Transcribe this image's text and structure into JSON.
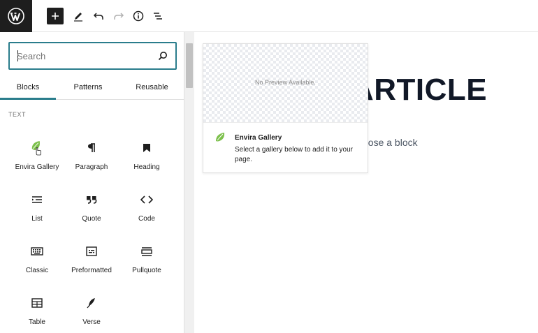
{
  "toolbar": {
    "logo": "wordpress-icon",
    "add": "plus-icon",
    "tools": "pencil-icon",
    "undo": "undo-icon",
    "redo": "redo-icon",
    "details": "info-icon",
    "outline": "list-view-icon"
  },
  "inserter": {
    "search": {
      "placeholder": "Search",
      "value": ""
    },
    "tabs": [
      {
        "label": "Blocks",
        "active": true
      },
      {
        "label": "Patterns",
        "active": false
      },
      {
        "label": "Reusable",
        "active": false
      }
    ],
    "category": "TEXT",
    "blocks": [
      {
        "label": "Envira Gallery",
        "icon": "leaf-icon"
      },
      {
        "label": "Paragraph",
        "icon": "pilcrow-icon"
      },
      {
        "label": "Heading",
        "icon": "bookmark-icon"
      },
      {
        "label": "List",
        "icon": "list-icon"
      },
      {
        "label": "Quote",
        "icon": "quote-icon"
      },
      {
        "label": "Code",
        "icon": "code-icon"
      },
      {
        "label": "Classic",
        "icon": "keyboard-icon"
      },
      {
        "label": "Preformatted",
        "icon": "preformatted-icon"
      },
      {
        "label": "Pullquote",
        "icon": "pullquote-icon"
      },
      {
        "label": "Table",
        "icon": "table-icon"
      },
      {
        "label": "Verse",
        "icon": "quill-icon"
      }
    ]
  },
  "canvas": {
    "heading": "ARTICLE",
    "placeholder": "oose a block"
  },
  "preview": {
    "note": "No Preview Available.",
    "title": "Envira Gallery",
    "description": "Select a gallery below to add it to your page."
  },
  "colors": {
    "accent": "#2a7d8c",
    "leaf": "#7cc04b",
    "dark": "#1e1e1e"
  }
}
